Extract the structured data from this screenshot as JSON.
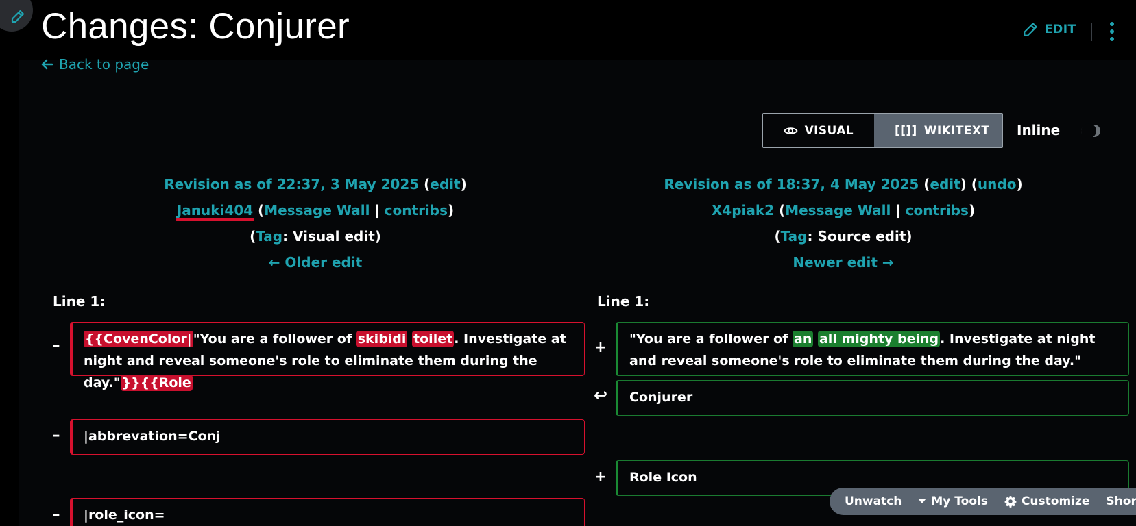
{
  "page": {
    "title": "Changes: Conjurer",
    "back_label": "Back to page",
    "edit_label": "EDIT"
  },
  "view_toggle": {
    "visual_label": "VISUAL",
    "wikitext_label": "WIKITEXT",
    "wikitext_glyph": "[[]]",
    "inline_label": "Inline",
    "selected": "WIKITEXT",
    "inline_on": false
  },
  "left_revision": {
    "heading": "Revision as of 22:37, 3 May 2025",
    "edit_link": "edit",
    "user": "Januki404",
    "message_wall": "Message Wall",
    "contribs": "contribs",
    "tag_link": "Tag",
    "tag_value": ": Visual edit)",
    "nav": "← Older edit"
  },
  "right_revision": {
    "heading": "Revision as of 18:37, 4 May 2025",
    "edit_link": "edit",
    "undo_link": "undo",
    "user": "X4piak2",
    "message_wall": "Message Wall",
    "contribs": "contribs",
    "tag_link": "Tag",
    "tag_value": ": Source edit)",
    "nav": "Newer edit →"
  },
  "diff": {
    "left_line_label": "Line 1:",
    "right_line_label": "Line 1:",
    "left_blocks": [
      {
        "marker": "–",
        "parts": [
          {
            "text": "{{CovenColor|",
            "hl": true
          },
          {
            "text": "\"You are a follower of ",
            "hl": false
          },
          {
            "text": "skibidi",
            "hl": true
          },
          {
            "text": " ",
            "hl": false
          },
          {
            "text": "toilet",
            "hl": true
          },
          {
            "text": ". Investigate at night and reveal someone's role to eliminate them during the day.\"",
            "hl": false
          },
          {
            "text": "}}{{Role",
            "hl": true
          }
        ]
      },
      {
        "marker": "–",
        "text": "|abbrevation=Conj"
      },
      {
        "marker": "–",
        "text": "|role_icon="
      }
    ],
    "right_blocks": [
      {
        "marker": "+",
        "parts": [
          {
            "text": "\"You are a follower of ",
            "hl": false
          },
          {
            "text": "an",
            "hl": true
          },
          {
            "text": " ",
            "hl": false
          },
          {
            "text": "all mighty being",
            "hl": true
          },
          {
            "text": ". Investigate at night and reveal someone's role to eliminate them during the day.\"",
            "hl": false
          }
        ]
      },
      {
        "marker": "↩",
        "text": "Conjurer"
      },
      {
        "marker": "+",
        "text": "Role Icon"
      }
    ]
  },
  "toolbar": {
    "unwatch": "Unwatch",
    "my_tools": "My Tools",
    "customize": "Customize",
    "shortcuts": "Shortcuts"
  },
  "colors": {
    "accent": "#1fa3b0",
    "deleted": "#d6112e",
    "added": "#1b7f2f",
    "background": "#050608"
  }
}
